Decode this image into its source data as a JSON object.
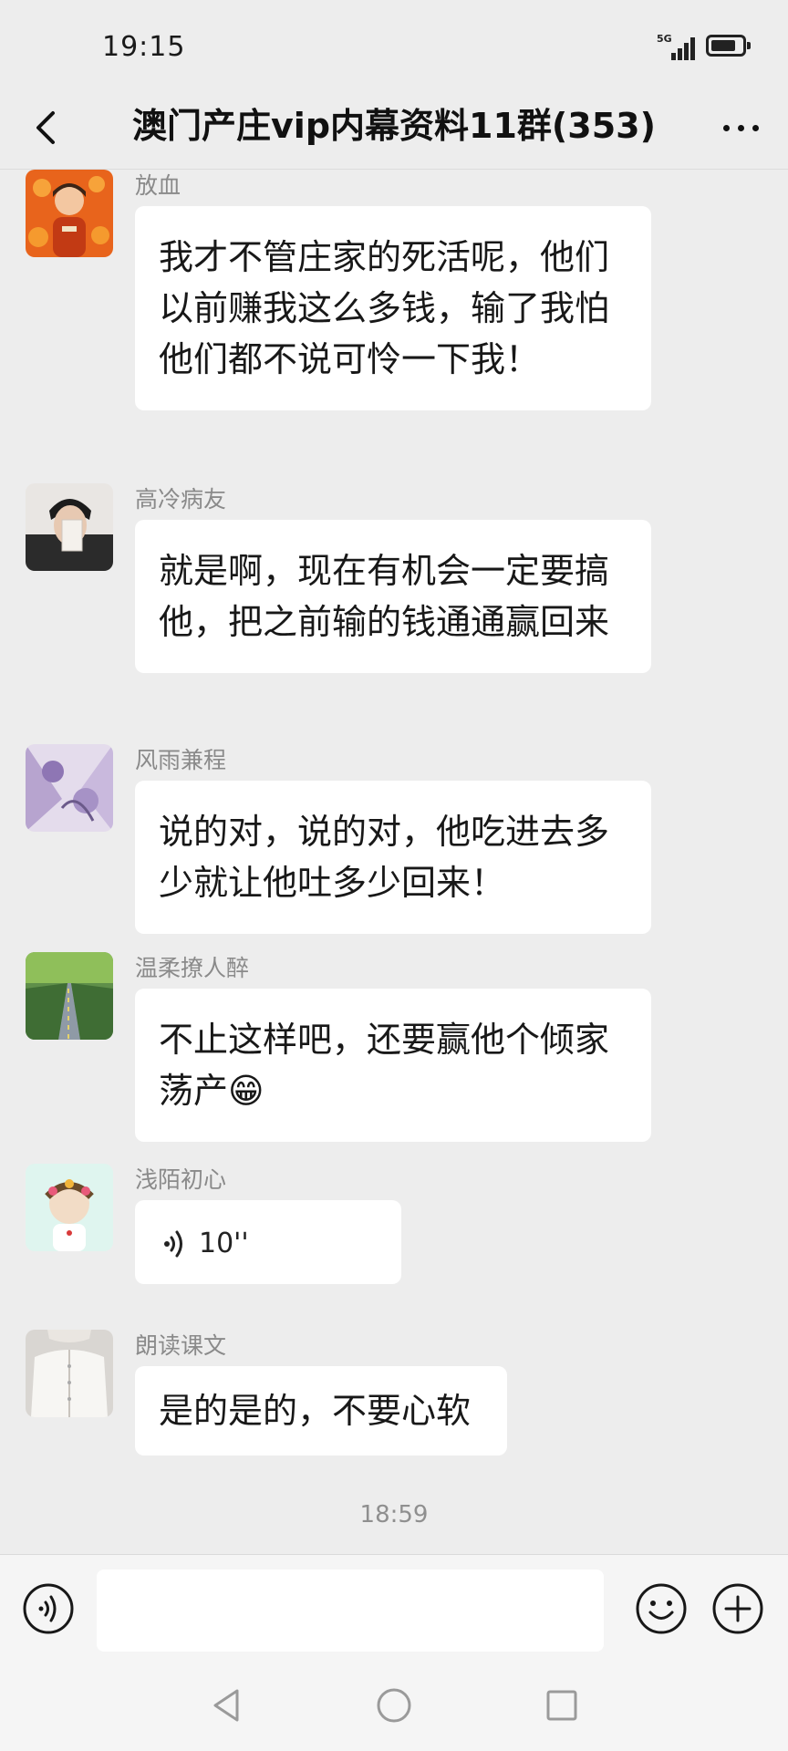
{
  "status_bar": {
    "time": "19:15",
    "network": "5G"
  },
  "header": {
    "title": "澳门产庄vip内幕资料11群(353)"
  },
  "messages": [
    {
      "sender": "放血",
      "text": "我才不管庄家的死活呢，他们以前赚我这么多钱，输了我怕他们都不说可怜一下我！"
    },
    {
      "sender": "高冷病友",
      "text": "就是啊，现在有机会一定要搞他，把之前输的钱通通赢回来"
    },
    {
      "sender": "风雨兼程",
      "text": "说的对，说的对，他吃进去多少就让他吐多少回来！"
    },
    {
      "sender": "温柔撩人醉",
      "text": "不止这样吧，还要赢他个倾家荡产😁"
    },
    {
      "sender": "浅陌初心",
      "voice_duration": "10''"
    },
    {
      "sender": "朗读课文",
      "text": "是的是的，不要心软"
    }
  ],
  "timestamp": "18:59",
  "input": {
    "value": "",
    "placeholder": ""
  },
  "icons": {
    "back": "chevron-left-icon",
    "more": "more-dots-icon",
    "voice_toggle": "voice-icon",
    "emoji": "smiley-icon",
    "plus": "plus-circle-icon",
    "sys_back": "triangle-back-icon",
    "sys_home": "circle-home-icon",
    "sys_recent": "square-recents-icon"
  },
  "colors": {
    "background": "#ededed",
    "bubble": "#ffffff",
    "sender_name": "#8a8a8a"
  }
}
